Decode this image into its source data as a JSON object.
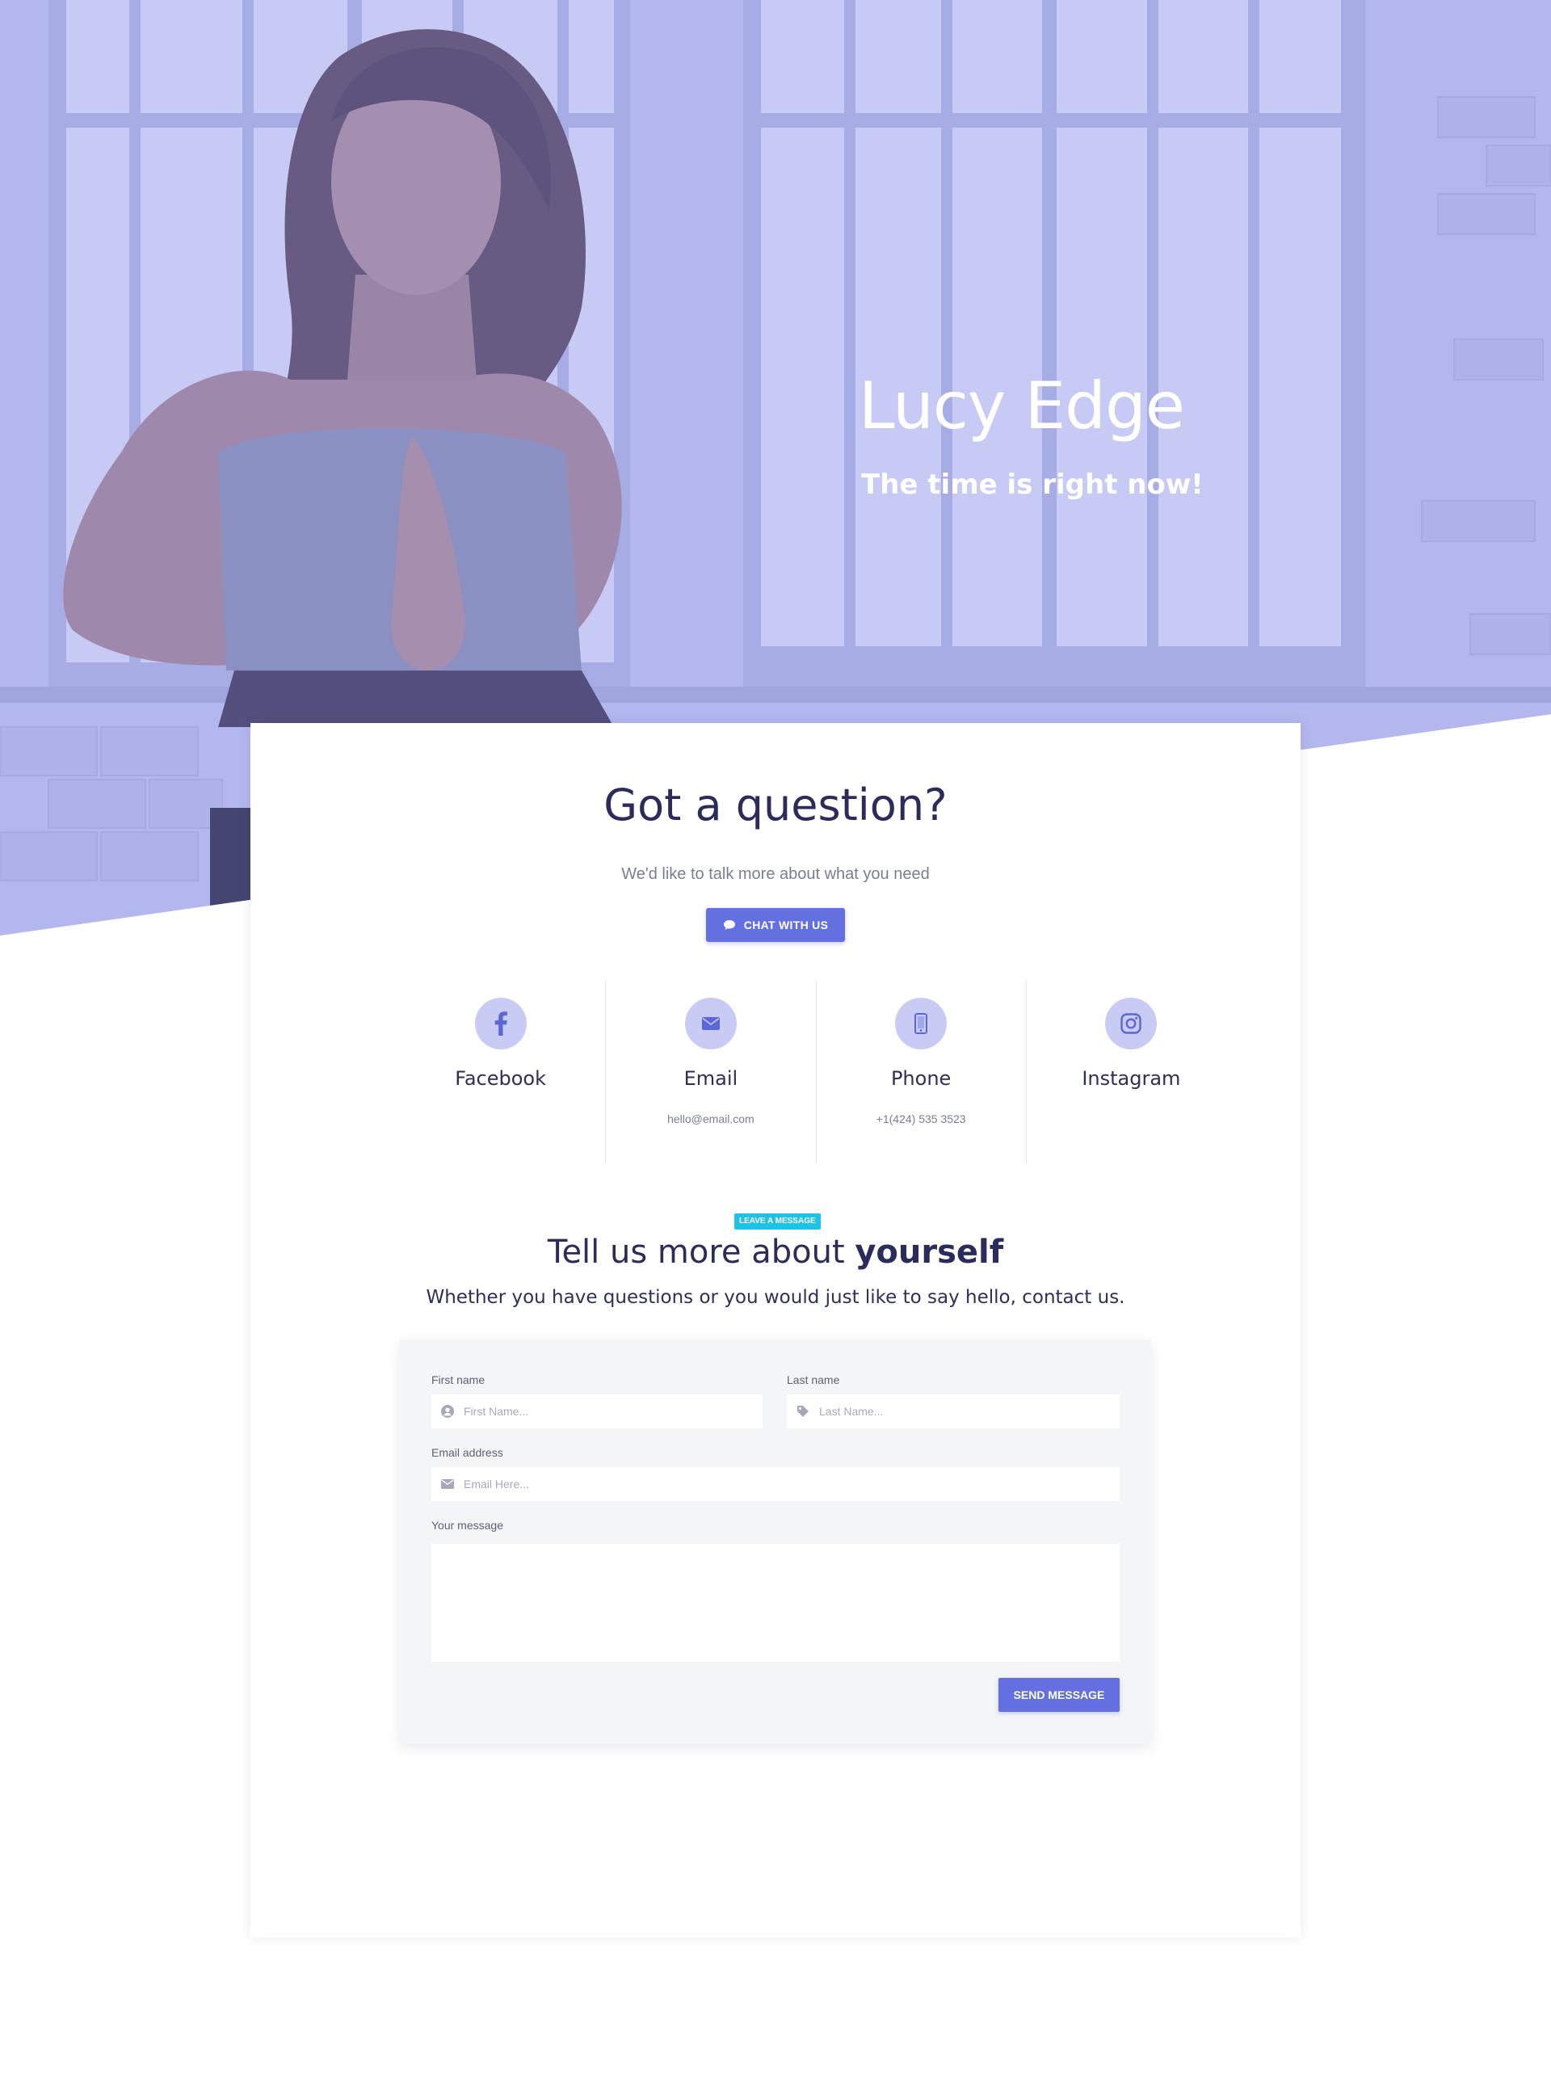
{
  "hero": {
    "title": "Lucy Edge",
    "subtitle": "The time is right now!"
  },
  "intro": {
    "title": "Got a question?",
    "subtitle": "We'd like to talk more about what you need",
    "chat_button": "CHAT WITH US"
  },
  "contacts": [
    {
      "label": "Facebook",
      "icon": "facebook-icon",
      "detail": ""
    },
    {
      "label": "Email",
      "icon": "envelope-icon",
      "detail": "hello@email.com"
    },
    {
      "label": "Phone",
      "icon": "mobile-phone-icon",
      "detail": "+1(424) 535 3523"
    },
    {
      "label": "Instagram",
      "icon": "instagram-icon",
      "detail": ""
    }
  ],
  "message_section": {
    "badge": "LEAVE A MESSAGE",
    "title_regular": "Tell us more about ",
    "title_bold": "yourself",
    "subtitle": "Whether you have questions or you would just like to say hello, contact us."
  },
  "form": {
    "first_name_label": "First name",
    "first_name_placeholder": "First Name...",
    "last_name_label": "Last name",
    "last_name_placeholder": "Last Name...",
    "email_label": "Email address",
    "email_placeholder": "Email Here...",
    "message_label": "Your message",
    "message_value": "",
    "send_button": "SEND MESSAGE"
  },
  "colors": {
    "accent": "#6470e0",
    "badge": "#1ec2e6",
    "icon_circle": "#c8ccf4",
    "heading": "#2c2c5c",
    "form_background": "#f4f5f7"
  }
}
